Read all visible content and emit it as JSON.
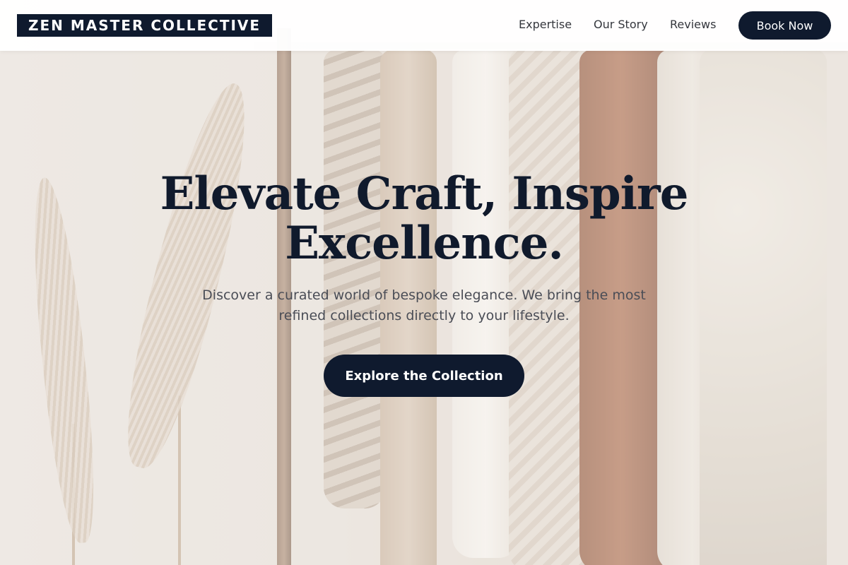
{
  "brand": {
    "logo_text": "ZEN MASTER COLLECTIVE"
  },
  "nav": {
    "links": [
      {
        "label": "Expertise"
      },
      {
        "label": "Our Story"
      },
      {
        "label": "Reviews"
      }
    ],
    "cta_label": "Book Now"
  },
  "hero": {
    "headline": "Elevate Craft, Inspire Excellence.",
    "subtitle": "Discover a curated world of bespoke elegance. We bring the most refined collections directly to your lifestyle.",
    "cta_label": "Explore the Collection"
  },
  "colors": {
    "primary": "#0f1a2e",
    "nav_bg": "#ffffff",
    "text_dark": "#101a2c",
    "text_muted": "#4a4d56"
  }
}
